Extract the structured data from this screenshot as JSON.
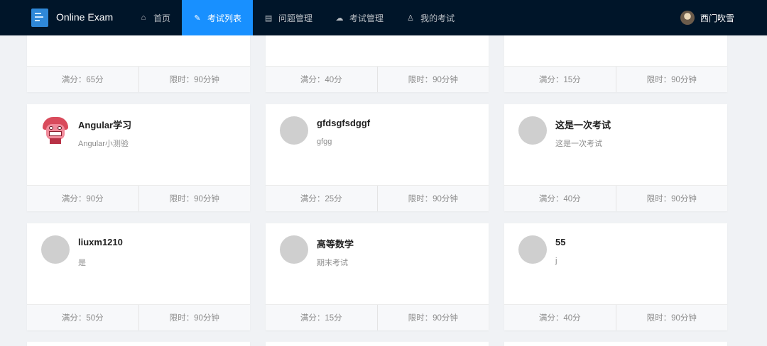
{
  "navbar": {
    "brand": "Online Exam",
    "menu": [
      {
        "label": "首页",
        "icon": "home-icon",
        "glyph": "⌂"
      },
      {
        "label": "考试列表",
        "icon": "exam-list-icon",
        "glyph": "✎"
      },
      {
        "label": "问题管理",
        "icon": "question-manage-icon",
        "glyph": "▤"
      },
      {
        "label": "考试管理",
        "icon": "exam-manage-icon",
        "glyph": "☁"
      },
      {
        "label": "我的考试",
        "icon": "user-icon",
        "glyph": "♙"
      }
    ],
    "active_index": 1,
    "username": "西门吹雪"
  },
  "exams": [
    {
      "title": "",
      "desc": "",
      "score": "满分：65分",
      "time": "限时：90分钟"
    },
    {
      "title": "",
      "desc": "",
      "score": "满分：40分",
      "time": "限时：90分钟"
    },
    {
      "title": "",
      "desc": "",
      "score": "满分：15分",
      "time": "限时：90分钟"
    },
    {
      "title": "Angular学习",
      "desc": "Angular小测验",
      "score": "满分：90分",
      "time": "限时：90分钟"
    },
    {
      "title": "gfdsgfsdggf",
      "desc": "gfgg",
      "score": "满分：25分",
      "time": "限时：90分钟"
    },
    {
      "title": "这是一次考试",
      "desc": "这是一次考试",
      "score": "满分：40分",
      "time": "限时：90分钟"
    },
    {
      "title": "liuxm1210",
      "desc": "是",
      "score": "满分：50分",
      "time": "限时：90分钟"
    },
    {
      "title": "高等数学",
      "desc": "期末考试",
      "score": "满分：15分",
      "time": "限时：90分钟"
    },
    {
      "title": "55",
      "desc": "j",
      "score": "满分：40分",
      "time": "限时：90分钟"
    }
  ],
  "colors": {
    "nav_bg": "#001529",
    "active": "#1890ff",
    "page_bg": "#f0f2f5"
  }
}
